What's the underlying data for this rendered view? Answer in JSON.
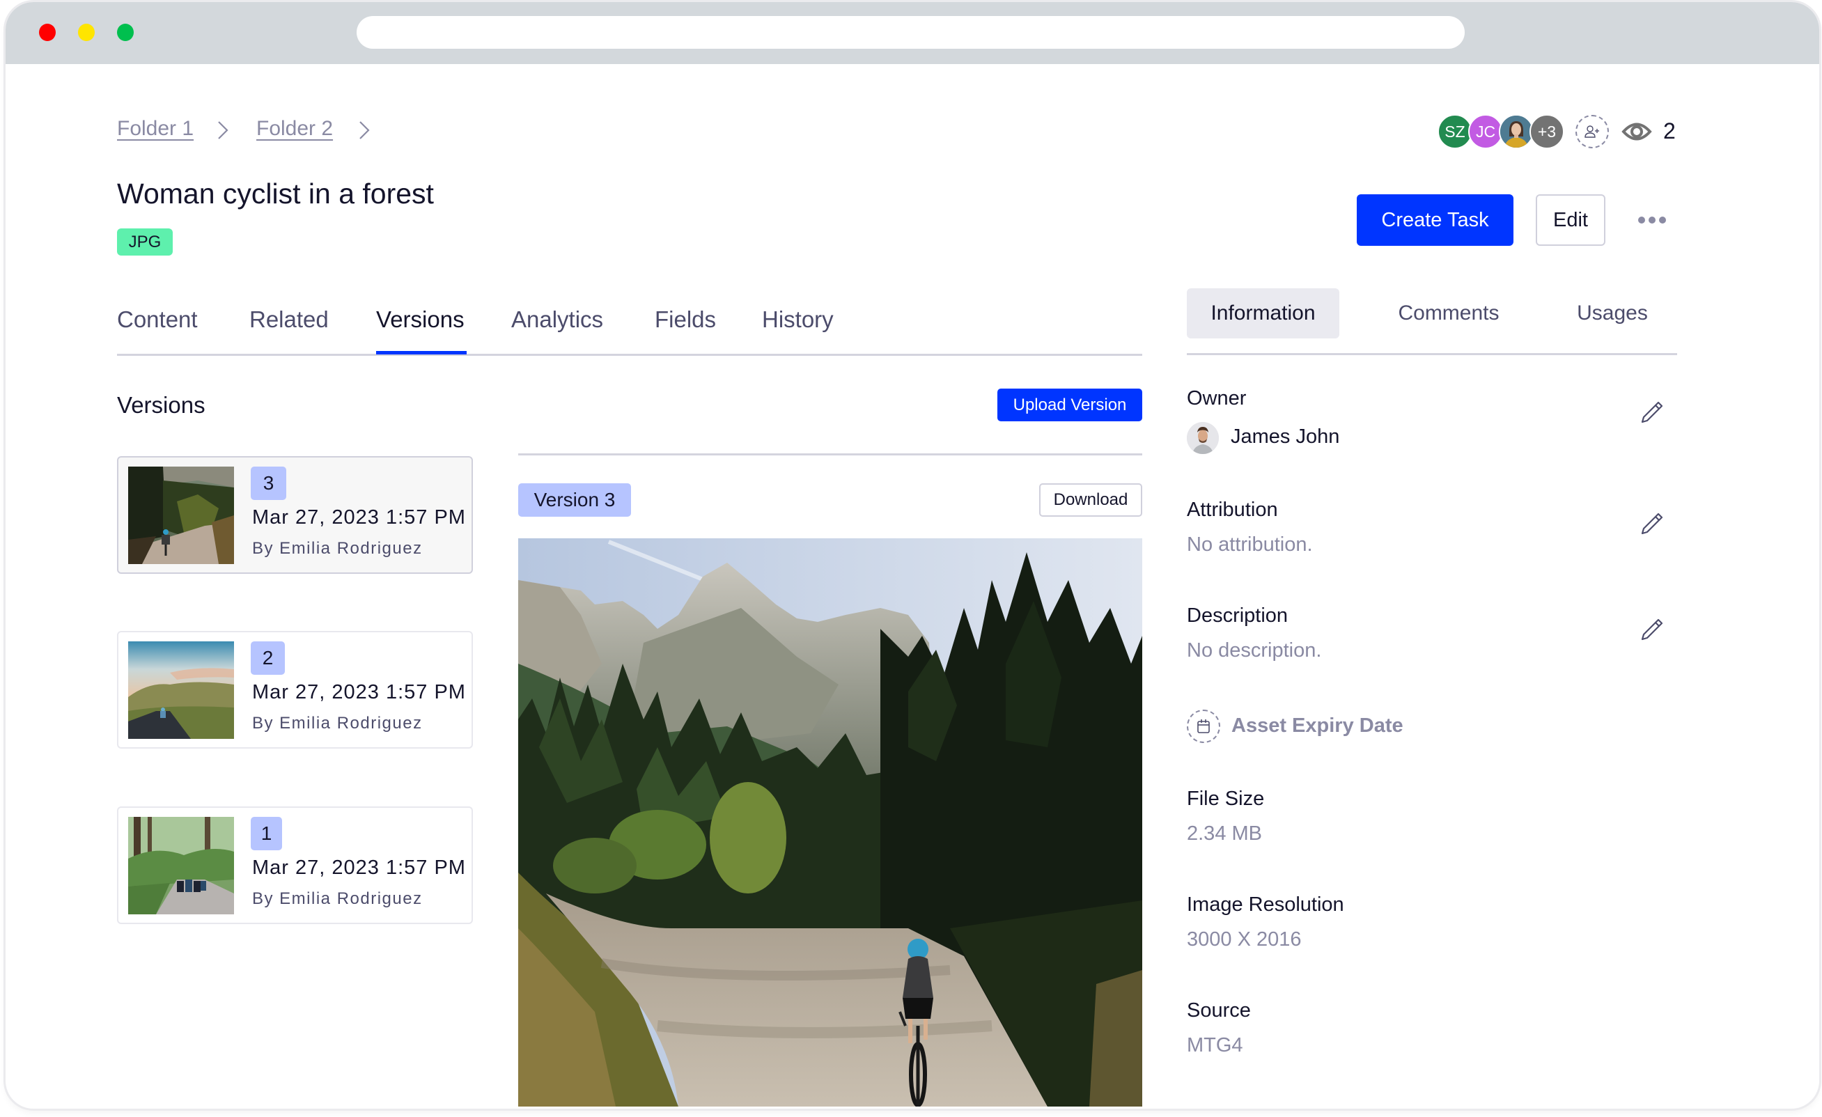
{
  "browser": {
    "traffic_lights": [
      {
        "name": "close",
        "color": "#ff0000"
      },
      {
        "name": "minimize",
        "color": "#ffe500"
      },
      {
        "name": "maximize",
        "color": "#00bf4e"
      }
    ],
    "url": ""
  },
  "breadcrumb": [
    {
      "label": "Folder 1"
    },
    {
      "label": "Folder 2"
    }
  ],
  "asset": {
    "title": "Woman cyclist in a forest",
    "type_badge": "JPG"
  },
  "collaborators": {
    "avatars": [
      {
        "initials": "SZ",
        "color": "#228b50"
      },
      {
        "initials": "JC",
        "color": "#c25be3"
      },
      {
        "initials": "",
        "kind": "photo",
        "color": "#4e7b92"
      },
      {
        "initials": "+3",
        "color": "#737373"
      }
    ],
    "add_user_icon": "add-user-icon",
    "viewers_icon": "eye-icon",
    "viewers_count": "2"
  },
  "actions": {
    "create_task": "Create Task",
    "edit": "Edit",
    "more_icon": "more-horizontal-icon"
  },
  "tabs": [
    {
      "label": "Content",
      "active": false
    },
    {
      "label": "Related",
      "active": false
    },
    {
      "label": "Versions",
      "active": true
    },
    {
      "label": "Analytics",
      "active": false
    },
    {
      "label": "Fields",
      "active": false
    },
    {
      "label": "History",
      "active": false
    }
  ],
  "versions": {
    "heading": "Versions",
    "upload_label": "Upload Version",
    "items": [
      {
        "number": "3",
        "date": "Mar 27, 2023 1:57 PM",
        "author": "By Emilia Rodriguez",
        "selected": true,
        "thumb": "forest-road"
      },
      {
        "number": "2",
        "date": "Mar 27, 2023 1:57 PM",
        "author": "By Emilia Rodriguez",
        "selected": false,
        "thumb": "hills-road"
      },
      {
        "number": "1",
        "date": "Mar 27, 2023 1:57 PM",
        "author": "By Emilia Rodriguez",
        "selected": false,
        "thumb": "green-forest"
      }
    ],
    "preview": {
      "badge": "Version 3",
      "download_label": "Download"
    }
  },
  "side_tabs": [
    {
      "label": "Information",
      "active": true
    },
    {
      "label": "Comments",
      "active": false
    },
    {
      "label": "Usages",
      "active": false
    }
  ],
  "info": {
    "owner": {
      "label": "Owner",
      "name": "James John"
    },
    "attribution": {
      "label": "Attribution",
      "value": "No attribution."
    },
    "description": {
      "label": "Description",
      "value": "No description."
    },
    "expiry": {
      "label": "Asset Expiry Date"
    },
    "file_size": {
      "label": "File Size",
      "value": "2.34 MB"
    },
    "resolution": {
      "label": "Image Resolution",
      "value": "3000 X 2016"
    },
    "source": {
      "label": "Source",
      "value": "MTG4"
    }
  },
  "colors": {
    "primary": "#0035ff",
    "badge_green": "#5ef0ad",
    "version_badge": "#b6c4ff",
    "text_dark": "#14142b",
    "text_muted": "#8a8aa3"
  }
}
